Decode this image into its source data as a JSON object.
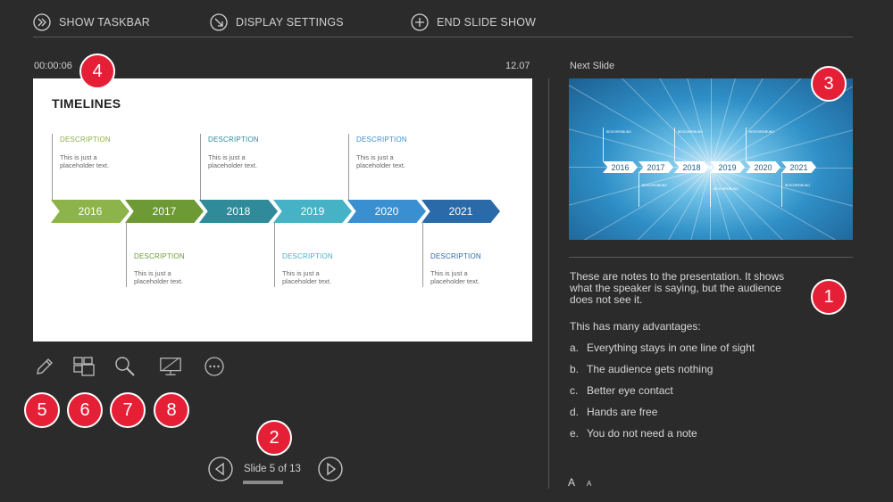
{
  "taskbar": {
    "show_taskbar": "SHOW TASKBAR",
    "display_settings": "DISPLAY SETTINGS",
    "end_slide_show": "END SLIDE SHOW"
  },
  "timer": "00:00:06",
  "clock": "12.07",
  "next_slide_label": "Next Slide",
  "current_slide": {
    "title": "TIMELINES",
    "description_label": "DESCRIPTION",
    "placeholder_line1": "This is just a",
    "placeholder_line2": "placeholder text.",
    "years": [
      "2016",
      "2017",
      "2018",
      "2019",
      "2020",
      "2021"
    ],
    "arrow_colors": [
      "#8db44a",
      "#6e9a36",
      "#2f8a9a",
      "#46b2c6",
      "#3a8fd0",
      "#2a6aa8"
    ],
    "desc_colors": [
      "#8ab04a",
      "#6e9a36",
      "#2f8a9a",
      "#46b2c6",
      "#3a8fd0",
      "#2a6aa8"
    ]
  },
  "next_slide": {
    "years": [
      "2016",
      "2017",
      "2018",
      "2019",
      "2020",
      "2021"
    ],
    "label": "BESCHREIBUNG"
  },
  "notes": {
    "paragraph": "These are notes to the presentation. It shows what the speaker is saying, but the audience does not see it.",
    "advantages_heading": "This has many advantages:",
    "items": [
      {
        "letter": "a.",
        "text": "Everything stays in one line of sight"
      },
      {
        "letter": "b.",
        "text": "The audience gets nothing"
      },
      {
        "letter": "c.",
        "text": "Better eye contact"
      },
      {
        "letter": "d.",
        "text": "Hands are free"
      },
      {
        "letter": "e.",
        "text": "You do not need a note"
      }
    ],
    "font_bigger": "A",
    "font_smaller": "A"
  },
  "navigation": {
    "counter": "Slide 5 of 13"
  },
  "badges": [
    "1",
    "2",
    "3",
    "4",
    "5",
    "6",
    "7",
    "8"
  ],
  "tools": [
    "pen-icon",
    "see-all-slides-icon",
    "zoom-icon",
    "black-screen-icon",
    "more-options-icon"
  ],
  "accent": "#e51f35"
}
